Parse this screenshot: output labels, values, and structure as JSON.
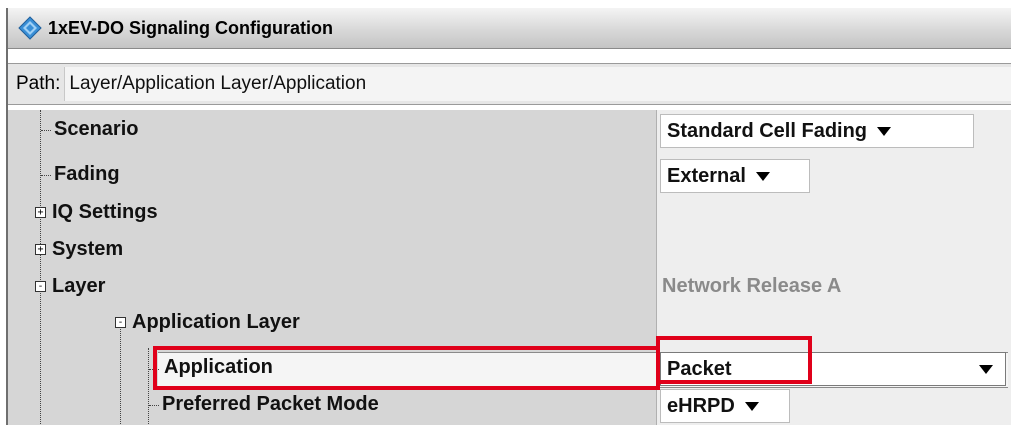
{
  "window": {
    "title": "1xEV-DO Signaling Configuration",
    "path_label": "Path:",
    "path_value": "Layer/Application Layer/Application"
  },
  "tree": {
    "items": [
      {
        "label": "Scenario",
        "value": "Standard Cell Fading",
        "value_type": "dropdown"
      },
      {
        "label": "Fading",
        "value": "External",
        "value_type": "dropdown"
      },
      {
        "label": "IQ Settings",
        "expander": "+"
      },
      {
        "label": "System",
        "expander": "+"
      },
      {
        "label": "Layer",
        "expander": "-",
        "value": "Network Release A",
        "value_type": "readonly"
      },
      {
        "label": "Application Layer",
        "expander": "-"
      },
      {
        "label": "Application",
        "value": "Packet",
        "value_type": "dropdown",
        "selected": true
      },
      {
        "label": "Preferred Packet Mode",
        "value": "eHRPD",
        "value_type": "dropdown"
      }
    ]
  },
  "colors": {
    "highlight": "#e0001a",
    "title_icon": "#3a8fd6"
  },
  "icons": {
    "title_icon": "diamond-logo-icon",
    "dropdown_arrow": "chevron-down-icon",
    "expand_plus": "expand-plus-icon",
    "collapse_minus": "collapse-minus-icon"
  }
}
